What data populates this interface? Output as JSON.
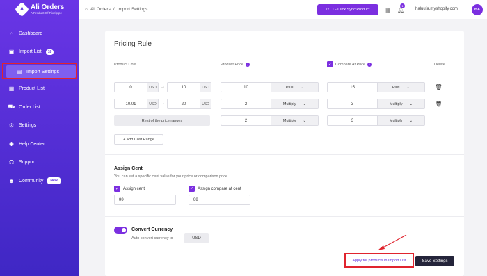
{
  "brand": {
    "title": "Ali Orders",
    "subtitle": "A Product Of Pixelpipe"
  },
  "sidebar": {
    "items": [
      {
        "label": "Dashboard",
        "icon": "home-icon"
      },
      {
        "label": "Import List",
        "icon": "import-icon",
        "badge": "18"
      },
      {
        "label": "Import Settings",
        "icon": "settings-list-icon"
      },
      {
        "label": "Product List",
        "icon": "box-icon"
      },
      {
        "label": "Order List",
        "icon": "cart-icon"
      },
      {
        "label": "Settings",
        "icon": "gear-icon"
      },
      {
        "label": "Help Center",
        "icon": "help-icon"
      },
      {
        "label": "Support",
        "icon": "headset-icon"
      },
      {
        "label": "Community",
        "icon": "community-icon",
        "badge": "New"
      }
    ]
  },
  "header": {
    "breadcrumb": [
      "All Orders",
      "Import Settings"
    ],
    "sync_label": "1 - Click Sync Product",
    "notif_count": "1",
    "store": "haluufa.myshopify.com",
    "avatar": "HA"
  },
  "pricing": {
    "title": "Pricing Rule",
    "col_cost": "Product Cost",
    "col_price": "Product Price",
    "col_compare": "Compare At Price",
    "col_delete": "Delete",
    "rows": [
      {
        "from": "0",
        "from_unit": "USD",
        "to": "10",
        "to_unit": "USD",
        "price": "10",
        "price_op": "Plus",
        "cmp": "15",
        "cmp_op": "Plus"
      },
      {
        "from": "10.01",
        "from_unit": "USD",
        "to": "20",
        "to_unit": "USD",
        "price": "2",
        "price_op": "Multiply",
        "cmp": "3",
        "cmp_op": "Multiply"
      }
    ],
    "rest": {
      "label": "Rest of the price ranges",
      "price": "2",
      "price_op": "Multiply",
      "cmp": "3",
      "cmp_op": "Multiply"
    },
    "add_label": "+ Add Cost Range"
  },
  "assign": {
    "title": "Assign Cent",
    "desc": "You can set a specific cent value for your price or comparison price.",
    "cent_label": "Assign cent",
    "cent_value": "99",
    "cmp_label": "Assign compare at cent",
    "cmp_value": "99"
  },
  "currency": {
    "title": "Convert Currency",
    "desc": "Auto convert currency to",
    "value": "USD"
  },
  "actions": {
    "apply": "Apply for products in Import List",
    "save": "Save Settings"
  },
  "colors": {
    "accent": "#7b2fe0",
    "highlight": "#e0242e",
    "dark": "#24243a"
  }
}
